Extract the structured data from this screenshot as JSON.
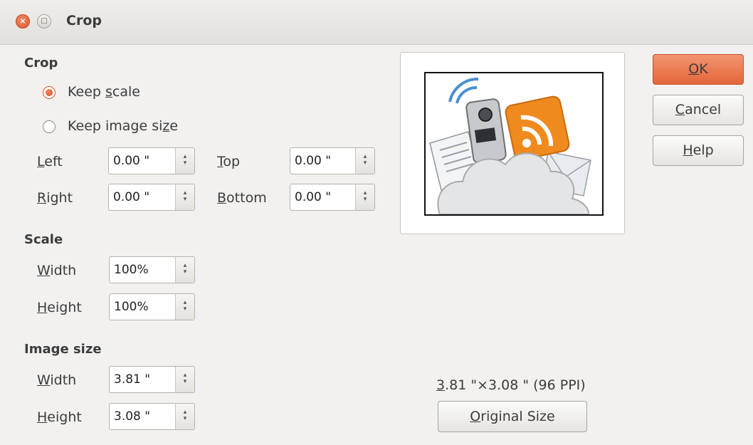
{
  "window": {
    "title": "Crop"
  },
  "crop": {
    "heading": "Crop",
    "options": [
      {
        "label_pre": "Keep ",
        "label_key": "s",
        "label_post": "cale",
        "selected": true
      },
      {
        "label_pre": "Keep image si",
        "label_key": "z",
        "label_post": "e",
        "selected": false
      }
    ],
    "left": {
      "key": "L",
      "rest": "eft",
      "value": "0.00 \""
    },
    "right": {
      "key": "R",
      "rest": "ight",
      "value": "0.00 \""
    },
    "top": {
      "key": "T",
      "rest": "op",
      "value": "0.00 \""
    },
    "bottom": {
      "key": "B",
      "rest": "ottom",
      "value": "0.00 \""
    }
  },
  "scale": {
    "heading": "Scale",
    "width": {
      "key": "W",
      "rest": "idth",
      "value": "100%"
    },
    "height": {
      "key": "H",
      "rest": "eight",
      "value": "100%"
    }
  },
  "image_size": {
    "heading": "Image size",
    "width": {
      "key": "W",
      "rest": "idth",
      "value": "3.81 \""
    },
    "height": {
      "key": "H",
      "rest": "eight",
      "value": "3.08 \""
    }
  },
  "original": {
    "info_key": "3",
    "info_rest": ".81 \"×3.08 \" (96 PPI)",
    "button_key": "O",
    "button_rest": "riginal Size"
  },
  "buttons": {
    "ok": {
      "key": "O",
      "rest": "K"
    },
    "cancel": {
      "key": "C",
      "rest": "ancel"
    },
    "help": {
      "key": "H",
      "rest": "elp"
    }
  },
  "colors": {
    "accent": "#e4663a",
    "background": "#f2f1f0"
  }
}
